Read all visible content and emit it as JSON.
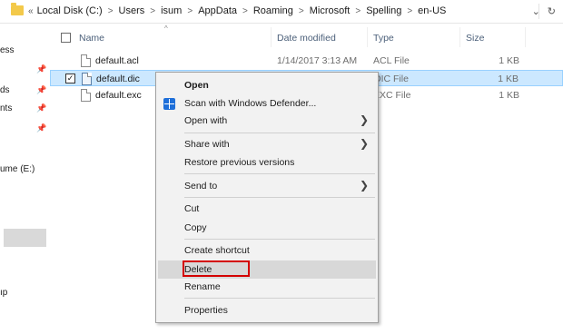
{
  "address": {
    "more": "«",
    "crumbs": [
      "Local Disk (C:)",
      "Users",
      "isum",
      "AppData",
      "Roaming",
      "Microsoft",
      "Spelling",
      "en-US"
    ],
    "dropdown": "⌄",
    "refresh": "↻"
  },
  "nav": {
    "items": [
      "ess",
      "ds",
      "nts",
      "ume (E:)",
      "ıp"
    ]
  },
  "columns": {
    "name": "Name",
    "date": "Date modified",
    "type": "Type",
    "size": "Size"
  },
  "files": [
    {
      "name": "default.acl",
      "date": "1/14/2017 3:13 AM",
      "type": "ACL File",
      "size": "1 KB",
      "selected": false
    },
    {
      "name": "default.dic",
      "date": "",
      "type": "DIC File",
      "size": "1 KB",
      "selected": true
    },
    {
      "name": "default.exc",
      "date": "",
      "type": "EXC File",
      "size": "1 KB",
      "selected": false
    }
  ],
  "context_menu": {
    "open": "Open",
    "scan": "Scan with Windows Defender...",
    "open_with": "Open with",
    "share_with": "Share with",
    "restore": "Restore previous versions",
    "send_to": "Send to",
    "cut": "Cut",
    "copy": "Copy",
    "create_shortcut": "Create shortcut",
    "delete": "Delete",
    "rename": "Rename",
    "properties": "Properties"
  },
  "colors": {
    "selection_bg": "#cce8ff",
    "menu_bg": "#f2f2f2",
    "highlight_outline": "#d40000"
  }
}
